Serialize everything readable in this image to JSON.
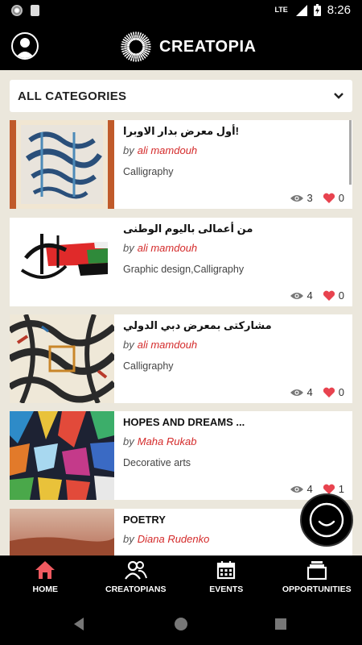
{
  "status_bar": {
    "network": "LTE",
    "time": "8:26"
  },
  "app": {
    "name": "CREATOPIA"
  },
  "filter": {
    "label": "ALL CATEGORIES"
  },
  "byline_prefix": "by",
  "posts": [
    {
      "title": "أول معرض بدار الاوبرا!",
      "author": "ali mamdouh",
      "category": "Calligraphy",
      "views": "3",
      "likes": "0"
    },
    {
      "title": "من أعمالى باليوم الوطنى",
      "author": "ali mamdouh",
      "category": "Graphic design,Calligraphy",
      "views": "4",
      "likes": "0"
    },
    {
      "title": "مشاركتى بمعرض دبي الدولي",
      "author": "ali mamdouh",
      "category": "Calligraphy",
      "views": "4",
      "likes": "0"
    },
    {
      "title": "HOPES AND DREAMS ...",
      "author": "Maha Rukab",
      "category": "Decorative arts",
      "views": "4",
      "likes": "1"
    },
    {
      "title": "POETRY",
      "author": "Diana Rudenko",
      "category": "",
      "views": "",
      "likes": ""
    }
  ],
  "bottom_nav": [
    {
      "label": "HOME",
      "icon": "home-icon",
      "active": true
    },
    {
      "label": "CREATOPIANS",
      "icon": "people-icon",
      "active": false
    },
    {
      "label": "EVENTS",
      "icon": "calendar-icon",
      "active": false
    },
    {
      "label": "OPPORTUNITIES",
      "icon": "stack-icon",
      "active": false
    }
  ],
  "colors": {
    "accent": "#d42a2a",
    "heart": "#e8434f",
    "home_active": "#ef5a60",
    "background": "#ebe7dc"
  }
}
